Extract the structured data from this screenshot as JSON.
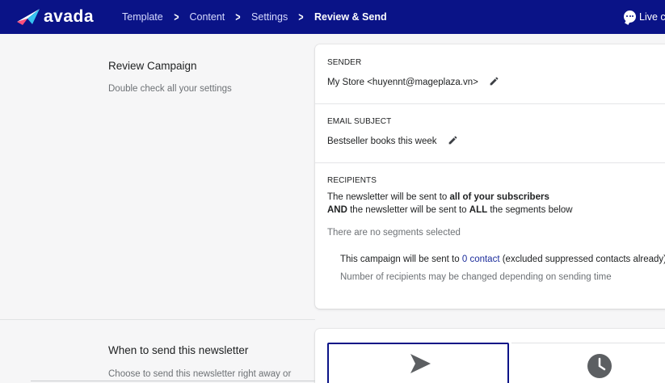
{
  "header": {
    "logo_text": "avada",
    "breadcrumbs": [
      "Template",
      "Content",
      "Settings",
      "Review & Send"
    ],
    "live_chat": "Live ch",
    "colors": {
      "bar": "#0a1387"
    }
  },
  "review": {
    "title": "Review Campaign",
    "description": "Double check all your settings",
    "sender": {
      "label": "SENDER",
      "value": "My Store <huyennt@mageplaza.vn>"
    },
    "subject": {
      "label": "EMAIL SUBJECT",
      "value": "Bestseller books this week"
    },
    "recipients": {
      "label": "RECIPIENTS",
      "line1_prefix": "The newsletter will be sent to ",
      "line1_bold": "all of your subscribers",
      "line2_bold1": "AND",
      "line2_mid": " the newsletter will be sent to ",
      "line2_bold2": "ALL",
      "line2_suffix": " the segments below",
      "no_segments": "There are no segments selected",
      "count_prefix": "This campaign will be sent to ",
      "count_link": "0 contact",
      "count_suffix": " (excluded suppressed contacts already)",
      "note": "Number of recipients may be changed depending on sending time"
    }
  },
  "send": {
    "title": "When to send this newsletter",
    "description": "Choose to send this newsletter right away or"
  },
  "icons": [
    "logo-icon",
    "chevron-right-icon",
    "chat-icon",
    "pencil-icon",
    "send-icon",
    "clock-icon"
  ]
}
